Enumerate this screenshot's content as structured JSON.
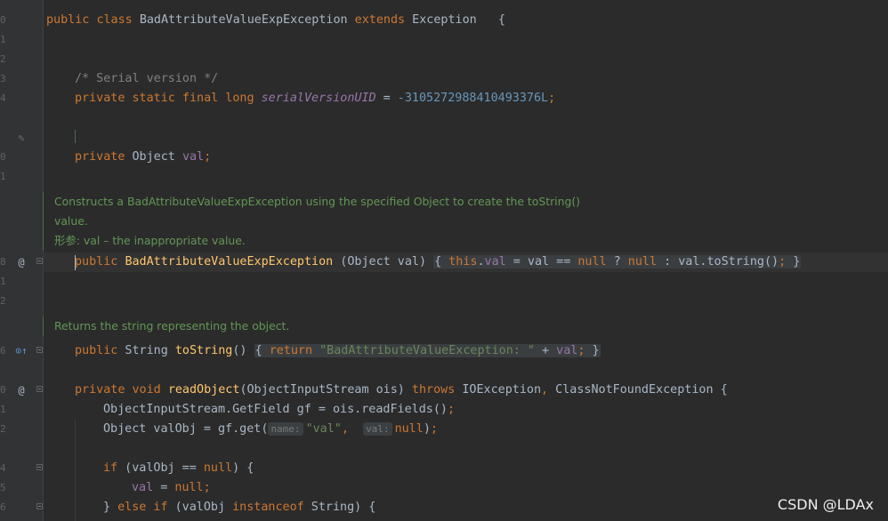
{
  "line_numbers": {
    "l1": "0",
    "l2": "1",
    "l3": "2",
    "l4": "3",
    "l5": "4",
    "l7": "0",
    "l8": "1",
    "l10": "8",
    "l11": "1",
    "l12": "2",
    "l14": "6",
    "l16": "0",
    "l17": "1",
    "l18": "2",
    "l20": "4",
    "l21": "5",
    "l22": "6"
  },
  "gutter_icons": {
    "edit": "pencil-icon",
    "annotation": "@",
    "override": "⊙↑"
  },
  "code": {
    "class_kw1": "public",
    "class_kw2": "class",
    "class_name": "BadAttributeValueExpException",
    "extends_kw": "extends",
    "super_class": "Exception",
    "class_brace": "{",
    "serial_comment": "/* Serial version */",
    "serial_mods": "private static final long",
    "serial_field": "serialVersionUID",
    "serial_eq": " = ",
    "serial_value": "-3105272988410493376L",
    "serial_semi": ";",
    "val_mods": "private",
    "val_type": "Object",
    "val_field": "val",
    "val_semi": ";",
    "ctor_public": "public",
    "ctor_name": "BadAttributeValueExpException",
    "ctor_params": " (Object val) ",
    "ctor_open": "{",
    "ctor_this": "this",
    "ctor_dot": ".",
    "ctor_val": "val",
    "ctor_assign": " = val == ",
    "ctor_null1": "null",
    "ctor_tern": " ? ",
    "ctor_null2": "null",
    "ctor_rest": " : val.toString()",
    "ctor_semi": ";",
    "ctor_close": "}",
    "ts_public": "public",
    "ts_type": " String ",
    "ts_name": "toString",
    "ts_parens": "() ",
    "ts_open": "{",
    "ts_return": "return",
    "ts_str": "\"BadAttributeValueException: \"",
    "ts_plus": " + ",
    "ts_val": "val",
    "ts_semi": ";",
    "ts_close": "}",
    "ro_mods": "private void",
    "ro_name": "readObject",
    "ro_params": "(ObjectInputStream ois) ",
    "ro_throws": "throws",
    "ro_exc1": " IOException",
    "ro_comma": ",",
    "ro_exc2": " ClassNotFoundException {",
    "gf_line": "ObjectInputStream.GetField gf = ois.readFields()",
    "gf_semi": ";",
    "valobj_start": "Object valObj = gf.get(",
    "hint_name": "name:",
    "valobj_str": "\"val\"",
    "valobj_comma": ",",
    "hint_val": "val:",
    "valobj_null": "null",
    "valobj_end": ")",
    "valobj_semi": ";",
    "if_kw": "if",
    "if_cond": " (valObj == ",
    "if_null": "null",
    "if_end": ") {",
    "assign_val": "val",
    "assign_eq": " = ",
    "assign_null": "null",
    "assign_semi": ";",
    "else_brace": "} ",
    "else_kw": "else if",
    "else_cond": " (valObj ",
    "instanceof_kw": "instanceof",
    "else_end": " String) {"
  },
  "docs": {
    "ctor_doc_line1": "Constructs a BadAttributeValueExpException using the specified Object to create the toString()",
    "ctor_doc_line2": "value.",
    "ctor_doc_params": "形参: val – the inappropriate value.",
    "ts_doc": "Returns the string representing the object."
  },
  "watermark": "CSDN @LDAx"
}
